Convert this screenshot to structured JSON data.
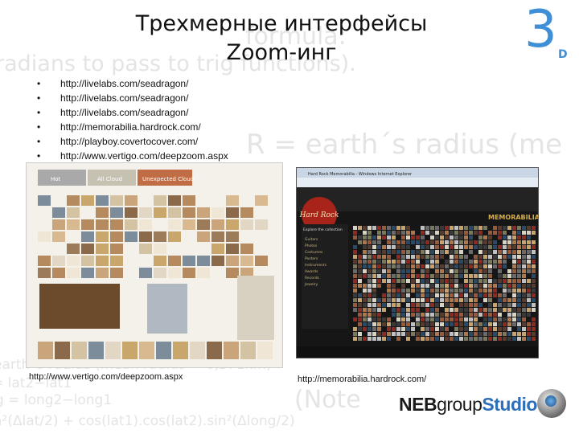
{
  "background_text": {
    "line1": "formula:",
    "line2": "radians to pass to trig functions).",
    "line3": "R = earth´s radius (me",
    "line4": "earth´s radius (mean radius = 6,371km)",
    "line5": "= lat2−lat1",
    "line6": "g = long2−long1",
    "line7": "(Note",
    "line8": "a²(Δlat/2) + cos(lat1).cos(lat2).sin²(Δlong/2)"
  },
  "header": {
    "title_line1": "Трехмерные интерфейсы",
    "title_line2": "Zoom-инг",
    "logo_number": "3",
    "logo_letter": "D"
  },
  "links": [
    "http://livelabs.com/seadragon/",
    "http://livelabs.com/seadragon/",
    "http://livelabs.com/seadragon/",
    "http://memorabilia.hardrock.com/",
    "http://playboy.covertocover.com/",
    "http://www.vertigo.com/deepzoom.aspx"
  ],
  "bullet": "•",
  "screenshots": {
    "left": {
      "tabs": [
        "Hot",
        "All Cloud",
        "Unexpected Cloud"
      ],
      "caption": "http://www.vertigo.com/deepzoom.aspx"
    },
    "right": {
      "browser_title": "Hard Rock Memorabilia - Windows Internet Explorer",
      "brand": "Hard Rock",
      "banner": "MEMORABILIA",
      "sidebar_heading": "Explore the collection",
      "sidebar_items": [
        "Guitars",
        "Photos",
        "Costumes",
        "Posters",
        "Instruments",
        "Awards",
        "Records",
        "Jewelry"
      ],
      "caption": "http://memorabilia.hardrock.com/"
    }
  },
  "footer": {
    "brand_part1": "NEB",
    "brand_part2": "group",
    "brand_part3": "Studio"
  },
  "colors": {
    "accent": "#3e8fd6",
    "background_text": "#e4e4e4"
  }
}
